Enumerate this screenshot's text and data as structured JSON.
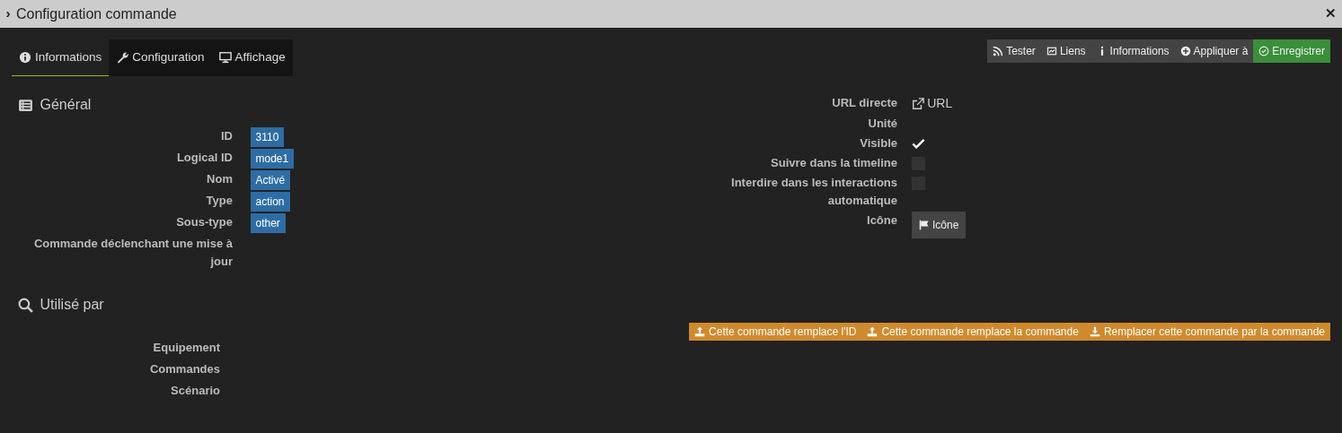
{
  "window": {
    "title": "Configuration commande",
    "collapse_glyph": "›",
    "close_glyph": "✕"
  },
  "tabs": [
    {
      "label": "Informations",
      "selected": true
    },
    {
      "label": "Configuration",
      "selected": false
    },
    {
      "label": "Affichage",
      "selected": false
    }
  ],
  "actions": [
    {
      "label": "Tester",
      "kind": "default"
    },
    {
      "label": "Liens",
      "kind": "default"
    },
    {
      "label": "Informations",
      "kind": "default"
    },
    {
      "label": "Appliquer à",
      "kind": "default"
    },
    {
      "label": "Enregistrer",
      "kind": "success"
    }
  ],
  "general": {
    "title": "Général",
    "fields": [
      {
        "label": "ID",
        "value": "3110"
      },
      {
        "label": "Logical ID",
        "value": "mode1"
      },
      {
        "label": "Nom",
        "value": "Activé"
      },
      {
        "label": "Type",
        "value": "action"
      },
      {
        "label": "Sous-type",
        "value": "other"
      },
      {
        "label": "Commande déclenchant une mise à jour"
      }
    ]
  },
  "properties": [
    {
      "label": "URL directe",
      "kind": "link",
      "value": "URL"
    },
    {
      "label": "Unité",
      "kind": "text"
    },
    {
      "label": "Visible",
      "kind": "checkbox",
      "checked": true
    },
    {
      "label": "Suivre dans la timeline",
      "kind": "checkbox",
      "checked": false
    },
    {
      "label": "Interdire dans les interactions automatique",
      "kind": "checkbox",
      "checked": false
    },
    {
      "label": "Icône",
      "kind": "button",
      "value": "Icône"
    }
  ],
  "used_by": {
    "title": "Utilisé par",
    "buttons": [
      {
        "label": "Cette commande remplace l'ID",
        "kind": "upload"
      },
      {
        "label": "Cette commande remplace la commande",
        "kind": "upload"
      },
      {
        "label": "Remplacer cette commande par la commande",
        "kind": "download"
      }
    ],
    "rows": [
      "Equipement",
      "Commandes",
      "Scénario"
    ]
  }
}
